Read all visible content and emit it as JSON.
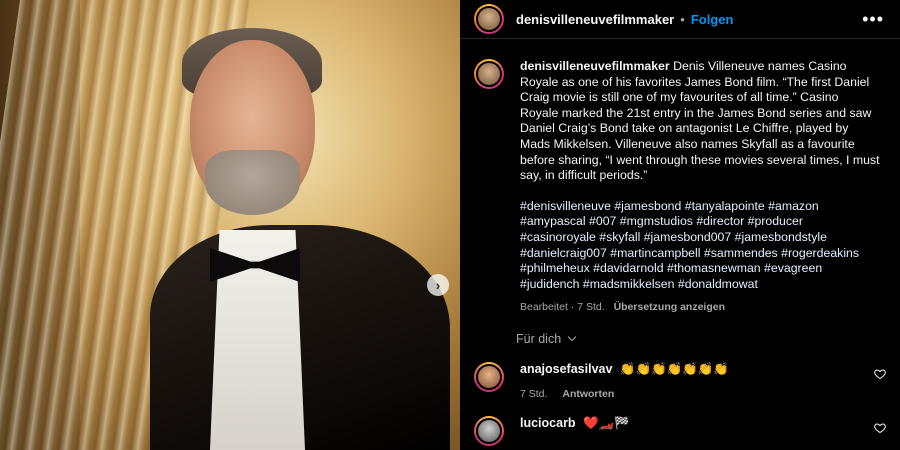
{
  "header": {
    "username": "denisvilleneuvefilmmaker",
    "separator": "•",
    "follow_label": "Folgen",
    "more_label": "•••"
  },
  "caption": {
    "username": "denisvilleneuvefilmmaker",
    "text": "Denis Villeneuve names Casino Royale as one of his favorites James Bond film. “The first Daniel Craig movie is still one of my favourites of all time.” Casino Royale marked the 21st entry in the James Bond series and saw Daniel Craig’s Bond take on antagonist Le Chiffre, played by Mads Mikkelsen. Villeneuve also names Skyfall as a favourite before sharing, “I went through these movies several times, I must say, in difficult periods.”",
    "hashtags": "#denisvilleneuve #jamesbond #tanyalapointe #amazon #amypascal #007 #mgmstudios #director #producer #casinoroyale #skyfall #jamesbond007 #jamesbondstyle #danielcraig007 #martincampbell #sammendes #rogerdeakins #philmeheux #davidarnold #thomasnewman #evagreen #judidench #madsmikkelsen #donaldmowat",
    "edited": "Bearbeitet · 7 Std.",
    "translate_label": "Übersetzung anzeigen"
  },
  "for_you_label": "Für dich",
  "comments": [
    {
      "username": "anajosefasilvav",
      "text": "👏👏👏👏👏👏👏",
      "time": "7 Std.",
      "reply_label": "Antworten"
    },
    {
      "username": "luciocarb",
      "text": "❤️🏎️🏁"
    }
  ],
  "colors": {
    "link": "#0095f6",
    "hashtag": "#e0f1ff",
    "muted": "#a8a8a8",
    "background": "#000000"
  }
}
